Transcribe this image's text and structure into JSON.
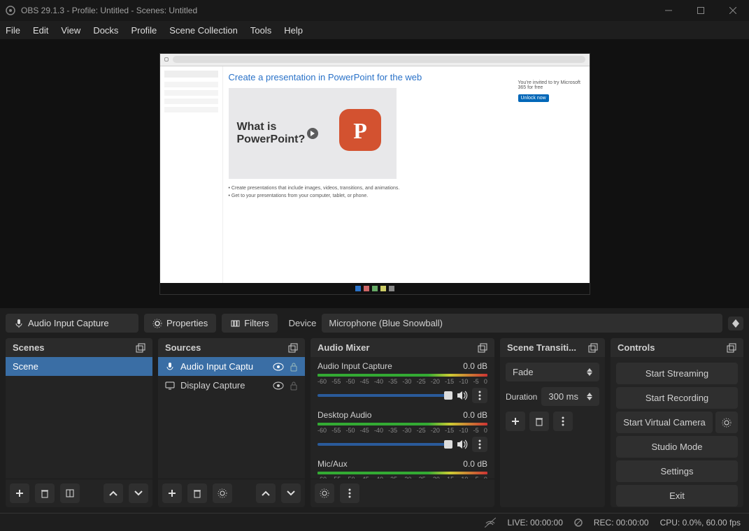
{
  "titlebar": {
    "title": "OBS 29.1.3 - Profile: Untitled - Scenes: Untitled"
  },
  "menu": {
    "items": [
      "File",
      "Edit",
      "View",
      "Docks",
      "Profile",
      "Scene Collection",
      "Tools",
      "Help"
    ]
  },
  "toolbar": {
    "source_label": "Audio Input Capture",
    "properties": "Properties",
    "filters": "Filters",
    "device_label": "Device",
    "device_value": "Microphone (Blue Snowball)"
  },
  "scenes": {
    "title": "Scenes",
    "items": [
      "Scene"
    ]
  },
  "sources": {
    "title": "Sources",
    "items": [
      {
        "icon": "mic",
        "label": "Audio Input Captu",
        "selected": true
      },
      {
        "icon": "display",
        "label": "Display Capture",
        "selected": false
      }
    ]
  },
  "mixer": {
    "title": "Audio Mixer",
    "ticks": [
      "-60",
      "-55",
      "-50",
      "-45",
      "-40",
      "-35",
      "-30",
      "-25",
      "-20",
      "-15",
      "-10",
      "-5",
      "0"
    ],
    "channels": [
      {
        "name": "Audio Input Capture",
        "level": "0.0 dB",
        "slider": true
      },
      {
        "name": "Desktop Audio",
        "level": "0.0 dB",
        "slider": true
      },
      {
        "name": "Mic/Aux",
        "level": "0.0 dB",
        "slider": false
      }
    ]
  },
  "transitions": {
    "title": "Scene Transiti...",
    "value": "Fade",
    "duration_label": "Duration",
    "duration_value": "300 ms"
  },
  "controls": {
    "title": "Controls",
    "buttons": [
      "Start Streaming",
      "Start Recording",
      "Start Virtual Camera",
      "Studio Mode",
      "Settings",
      "Exit"
    ]
  },
  "status": {
    "live": "LIVE: 00:00:00",
    "rec": "REC: 00:00:00",
    "cpu": "CPU: 0.0%, 60.00 fps"
  },
  "preview": {
    "headline": "Create a presentation in PowerPoint for the web",
    "subhead": "What is PowerPoint?",
    "side_title": "You're invited to try Microsoft 365 for free",
    "side_button": "Unlock now"
  }
}
